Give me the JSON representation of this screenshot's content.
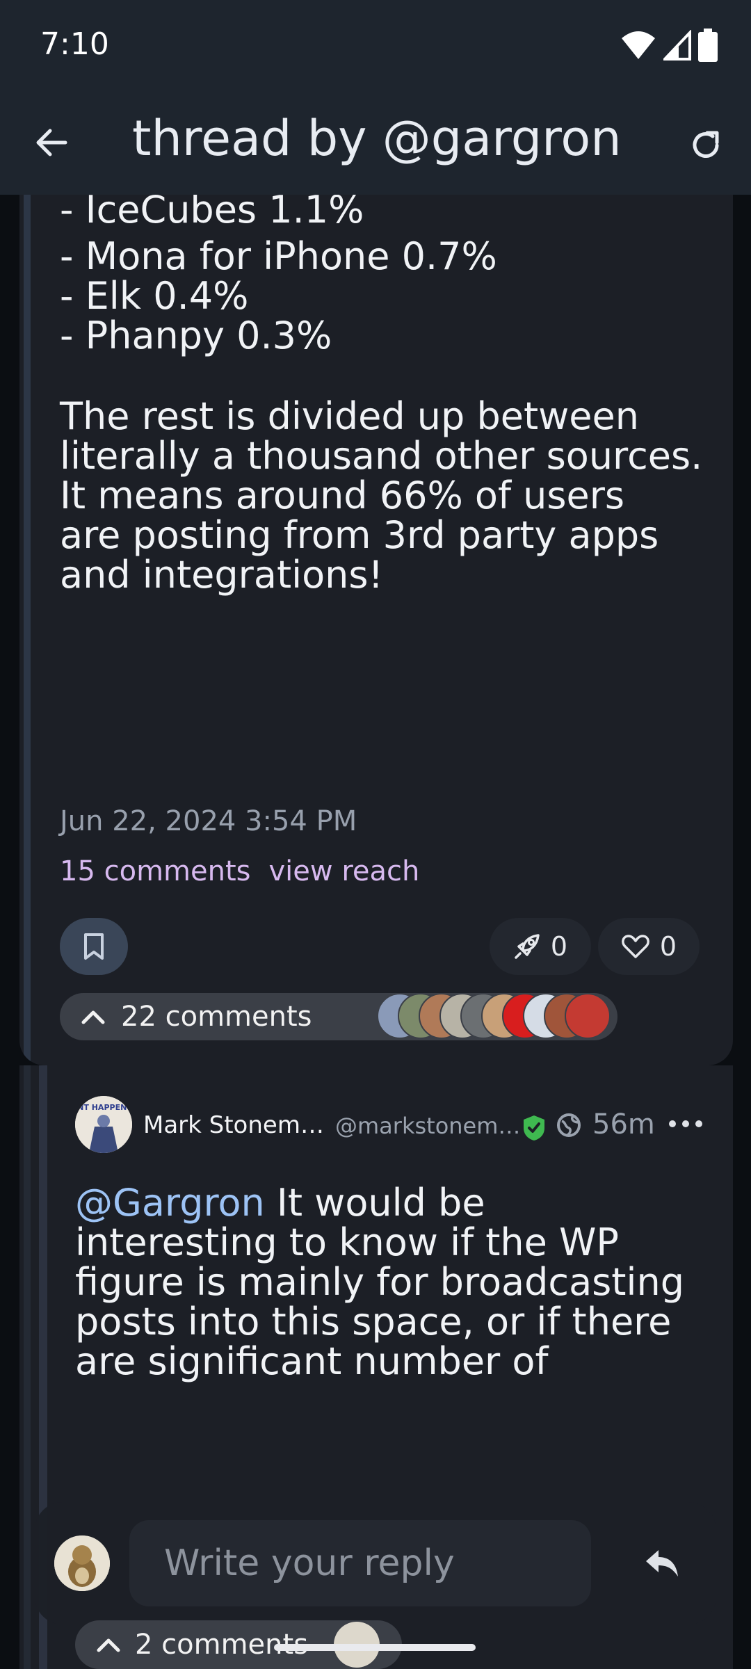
{
  "status_bar": {
    "time": "7:10"
  },
  "header": {
    "title": "thread by @gargron"
  },
  "post": {
    "lines": [
      "- IceCubes 1.1%",
      "- Mona for iPhone 0.7%",
      "- Elk 0.4%",
      "- Phanpy 0.3%",
      "The rest is divided up between",
      "literally a thousand other sources.",
      "It means around 66% of users",
      "are posting from 3rd party apps",
      "and integrations!"
    ],
    "date": "Jun 22, 2024 3:54 PM",
    "comments_link": "15 comments",
    "view_reach_link": "view reach",
    "boost_count": "0",
    "like_count": "0",
    "comments_expander": "22 comments"
  },
  "reply": {
    "name": "Mark Stonem…",
    "handle": "@markstonem…",
    "time": "56m",
    "avatar_text": "IT CANT HAPPEN HERE",
    "mention": "@Gargron",
    "first_line_rest": " It would be",
    "lines": [
      "interesting to know if the WP",
      "figure is mainly for broadcasting",
      "posts into this space, or if there",
      "are significant number of"
    ]
  },
  "composer": {
    "placeholder": "Write your reply"
  },
  "sub_comments": {
    "label": "2 comments"
  },
  "colors": {
    "accent_link": "#d7b9ef",
    "mention": "#9dc3f5",
    "verified": "#3fb950"
  }
}
